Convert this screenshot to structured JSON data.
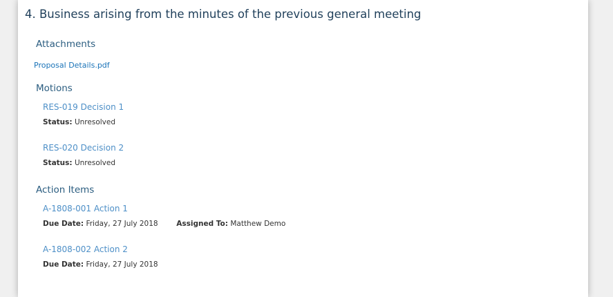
{
  "agenda_item": {
    "title": "4. Business arising from the minutes of the previous general meeting"
  },
  "attachments": {
    "heading": "Attachments",
    "files": [
      "Proposal Details.pdf"
    ]
  },
  "motions": {
    "heading": "Motions",
    "items": [
      {
        "title": "RES-019 Decision 1",
        "status_label": "Status:",
        "status": "Unresolved"
      },
      {
        "title": "RES-020 Decision 2",
        "status_label": "Status:",
        "status": "Unresolved"
      }
    ]
  },
  "action_items": {
    "heading": "Action Items",
    "items": [
      {
        "title": "A-1808-001 Action 1",
        "due_label": "Due Date:",
        "due": "Friday, 27 July 2018",
        "assigned_label": "Assigned To:",
        "assigned": "Matthew Demo"
      },
      {
        "title": "A-1808-002 Action 2",
        "due_label": "Due Date:",
        "due": "Friday, 27 July 2018"
      }
    ]
  },
  "colors": {
    "title": "#1f3f5a",
    "heading": "#2b5d80",
    "link": "#4d8fc7",
    "attachment_link": "#1a73b8"
  }
}
